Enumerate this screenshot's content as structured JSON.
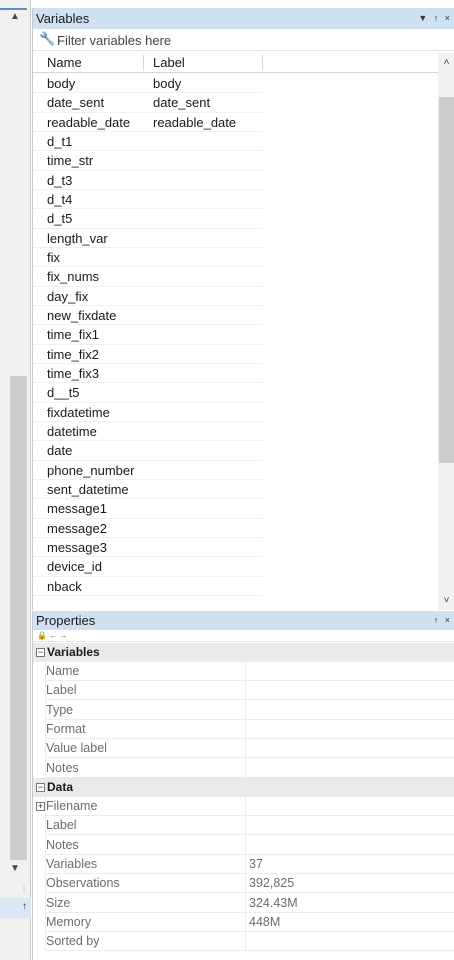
{
  "variables_panel": {
    "title": "Variables",
    "controls": "▼ ↑ ×",
    "filter_placeholder": "Filter variables here",
    "columns": {
      "name": "Name",
      "label": "Label"
    },
    "rows": [
      {
        "name": "body",
        "label": "body"
      },
      {
        "name": "date_sent",
        "label": "date_sent"
      },
      {
        "name": "readable_date",
        "label": "readable_date"
      },
      {
        "name": "d_t1",
        "label": ""
      },
      {
        "name": "time_str",
        "label": ""
      },
      {
        "name": "d_t3",
        "label": ""
      },
      {
        "name": "d_t4",
        "label": ""
      },
      {
        "name": "d_t5",
        "label": ""
      },
      {
        "name": "length_var",
        "label": ""
      },
      {
        "name": "fix",
        "label": ""
      },
      {
        "name": "fix_nums",
        "label": ""
      },
      {
        "name": "day_fix",
        "label": ""
      },
      {
        "name": "new_fixdate",
        "label": ""
      },
      {
        "name": "time_fix1",
        "label": ""
      },
      {
        "name": "time_fix2",
        "label": ""
      },
      {
        "name": "time_fix3",
        "label": ""
      },
      {
        "name": "d__t5",
        "label": ""
      },
      {
        "name": "fixdatetime",
        "label": ""
      },
      {
        "name": "datetime",
        "label": ""
      },
      {
        "name": "date",
        "label": ""
      },
      {
        "name": "phone_number",
        "label": ""
      },
      {
        "name": "sent_datetime",
        "label": ""
      },
      {
        "name": "message1",
        "label": ""
      },
      {
        "name": "message2",
        "label": ""
      },
      {
        "name": "message3",
        "label": ""
      },
      {
        "name": "device_id",
        "label": ""
      },
      {
        "name": "nback",
        "label": ""
      }
    ]
  },
  "properties_panel": {
    "title": "Properties",
    "controls": "↑ ×",
    "toolbar": "▲ ← →",
    "variables_section": {
      "title": "Variables",
      "rows": [
        {
          "key": "Name",
          "value": ""
        },
        {
          "key": "Label",
          "value": ""
        },
        {
          "key": "Type",
          "value": ""
        },
        {
          "key": "Format",
          "value": ""
        },
        {
          "key": "Value label",
          "value": ""
        },
        {
          "key": "Notes",
          "value": ""
        }
      ]
    },
    "data_section": {
      "title": "Data",
      "rows": [
        {
          "key": "Filename",
          "value": ""
        },
        {
          "key": "Label",
          "value": ""
        },
        {
          "key": "Notes",
          "value": ""
        },
        {
          "key": "Variables",
          "value": "37"
        },
        {
          "key": "Observations",
          "value": "392,825"
        },
        {
          "key": "Size",
          "value": "324.43M"
        },
        {
          "key": "Memory",
          "value": "448M"
        },
        {
          "key": "Sorted by",
          "value": ""
        }
      ]
    }
  },
  "icons": {
    "filter": "wrench-icon",
    "collapse": "minus-box-icon",
    "expand": "plus-box-icon"
  }
}
